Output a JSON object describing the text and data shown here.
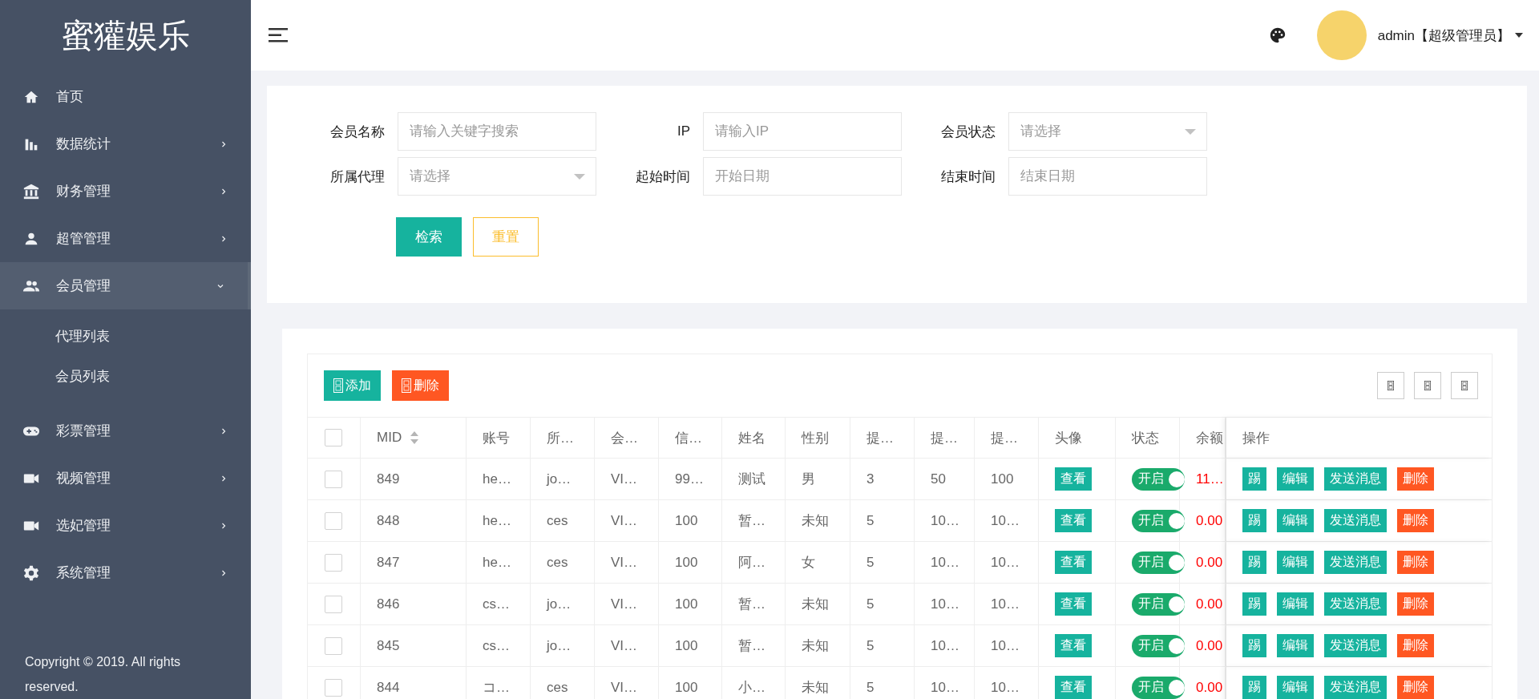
{
  "sidebar": {
    "logo": "蜜獾娱乐",
    "items": [
      {
        "label": "首页",
        "expandable": false,
        "expanded": false,
        "selected": false
      },
      {
        "label": "数据统计",
        "expandable": true,
        "expanded": false,
        "selected": false
      },
      {
        "label": "财务管理",
        "expandable": true,
        "expanded": false,
        "selected": false
      },
      {
        "label": "超管管理",
        "expandable": true,
        "expanded": false,
        "selected": false
      },
      {
        "label": "会员管理",
        "expandable": true,
        "expanded": true,
        "selected": true,
        "children": [
          {
            "label": "代理列表"
          },
          {
            "label": "会员列表"
          }
        ]
      },
      {
        "label": "彩票管理",
        "expandable": true,
        "expanded": false,
        "selected": false
      },
      {
        "label": "视频管理",
        "expandable": true,
        "expanded": false,
        "selected": false
      },
      {
        "label": "选妃管理",
        "expandable": true,
        "expanded": false,
        "selected": false
      },
      {
        "label": "系统管理",
        "expandable": true,
        "expanded": false,
        "selected": false
      }
    ],
    "copyright": "Copyright © 2019. All rights reserved."
  },
  "header": {
    "user": "admin【超级管理员】"
  },
  "search_form": {
    "fields": [
      {
        "label": "会员名称",
        "kind": "text",
        "placeholder": "请输入关键字搜索"
      },
      {
        "label": "IP",
        "kind": "text",
        "placeholder": "请输入IP"
      },
      {
        "label": "会员状态",
        "kind": "select",
        "placeholder": "请选择"
      },
      {
        "label": "所属代理",
        "kind": "select",
        "placeholder": "请选择"
      },
      {
        "label": "起始时间",
        "kind": "text",
        "placeholder": "开始日期"
      },
      {
        "label": "结束时间",
        "kind": "text",
        "placeholder": "结束日期"
      }
    ],
    "buttons": [
      {
        "label": "检索",
        "kind": "primary"
      },
      {
        "label": "重置",
        "kind": "outline"
      }
    ]
  },
  "table": {
    "toolbar": [
      {
        "label": "添加",
        "kind": "primary"
      },
      {
        "label": "删除",
        "kind": "danger"
      }
    ],
    "all_selected": false,
    "columns": [
      {
        "label": "MID",
        "sortable": true
      },
      {
        "label": "账号",
        "sortable": false
      },
      {
        "label": "所…",
        "sortable": false
      },
      {
        "label": "会…",
        "sortable": false
      },
      {
        "label": "信…",
        "sortable": false
      },
      {
        "label": "姓名",
        "sortable": false
      },
      {
        "label": "性别",
        "sortable": false
      },
      {
        "label": "提…",
        "sortable": false
      },
      {
        "label": "提…",
        "sortable": false
      },
      {
        "label": "提…",
        "sortable": false
      },
      {
        "label": "头像",
        "sortable": false
      },
      {
        "label": "状态",
        "sortable": false
      },
      {
        "label": "余额",
        "sortable": false
      },
      {
        "label": "操作",
        "sortable": false
      }
    ],
    "rows": [
      {
        "selected": false,
        "cells": [
          "849",
          "he…",
          "jo…",
          "VI…",
          "99…",
          "测试",
          "男",
          "3",
          "50",
          "100"
        ],
        "avatar": "查看",
        "status": {
          "label": "开启",
          "on": true
        },
        "balance": "11…",
        "actions": [
          {
            "label": "踢",
            "kind": "primary"
          },
          {
            "label": "编辑",
            "kind": "primary"
          },
          {
            "label": "发送消息",
            "kind": "primary"
          },
          {
            "label": "删除",
            "kind": "danger"
          }
        ]
      },
      {
        "selected": false,
        "cells": [
          "848",
          "he…",
          "ces",
          "VI…",
          "100",
          "暂…",
          "未知",
          "5",
          "10…",
          "10…"
        ],
        "avatar": "查看",
        "status": {
          "label": "开启",
          "on": true
        },
        "balance": "0.00",
        "actions": [
          {
            "label": "踢",
            "kind": "primary"
          },
          {
            "label": "编辑",
            "kind": "primary"
          },
          {
            "label": "发送消息",
            "kind": "primary"
          },
          {
            "label": "删除",
            "kind": "danger"
          }
        ]
      },
      {
        "selected": false,
        "cells": [
          "847",
          "he…",
          "ces",
          "VI…",
          "100",
          "阿…",
          "女",
          "5",
          "10…",
          "10…"
        ],
        "avatar": "查看",
        "status": {
          "label": "开启",
          "on": true
        },
        "balance": "0.00",
        "actions": [
          {
            "label": "踢",
            "kind": "primary"
          },
          {
            "label": "编辑",
            "kind": "primary"
          },
          {
            "label": "发送消息",
            "kind": "primary"
          },
          {
            "label": "删除",
            "kind": "danger"
          }
        ]
      },
      {
        "selected": false,
        "cells": [
          "846",
          "cs…",
          "jo…",
          "VI…",
          "100",
          "暂…",
          "未知",
          "5",
          "10…",
          "10…"
        ],
        "avatar": "查看",
        "status": {
          "label": "开启",
          "on": true
        },
        "balance": "0.00",
        "actions": [
          {
            "label": "踢",
            "kind": "primary"
          },
          {
            "label": "编辑",
            "kind": "primary"
          },
          {
            "label": "发送消息",
            "kind": "primary"
          },
          {
            "label": "删除",
            "kind": "danger"
          }
        ]
      },
      {
        "selected": false,
        "cells": [
          "845",
          "cs…",
          "jo…",
          "VI…",
          "100",
          "暂…",
          "未知",
          "5",
          "10…",
          "10…"
        ],
        "avatar": "查看",
        "status": {
          "label": "开启",
          "on": true
        },
        "balance": "0.00",
        "actions": [
          {
            "label": "踢",
            "kind": "primary"
          },
          {
            "label": "编辑",
            "kind": "primary"
          },
          {
            "label": "发送消息",
            "kind": "primary"
          },
          {
            "label": "删除",
            "kind": "danger"
          }
        ]
      },
      {
        "selected": false,
        "cells": [
          "844",
          "コ…",
          "ces",
          "VI…",
          "100",
          "小…",
          "未知",
          "5",
          "10…",
          "10…"
        ],
        "avatar": "查看",
        "status": {
          "label": "开启",
          "on": true
        },
        "balance": "0.00",
        "actions": [
          {
            "label": "踢",
            "kind": "primary"
          },
          {
            "label": "编辑",
            "kind": "primary"
          },
          {
            "label": "发送消息",
            "kind": "primary"
          },
          {
            "label": "删除",
            "kind": "danger"
          }
        ]
      }
    ]
  }
}
